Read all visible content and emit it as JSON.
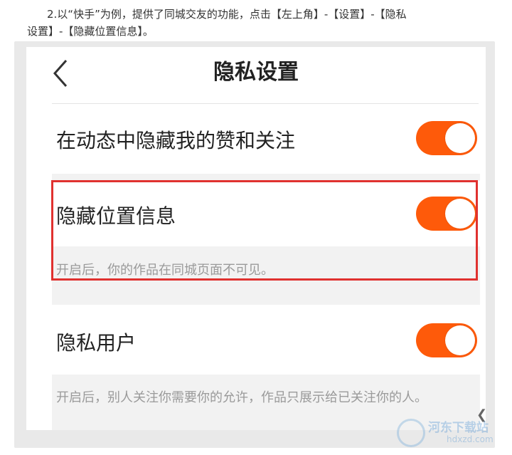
{
  "article": {
    "line1": "2.以“快手”为例，提供了同城交友的功能，点击【左上角】-【设置】-【隐私",
    "line2": "设置】-【隐藏位置信息】。"
  },
  "screen": {
    "title": "隐私设置",
    "back_icon": "chevron-left-icon",
    "accent": "#fe5a0a",
    "highlight_color": "#e0312f",
    "settings": [
      {
        "label": "在动态中隐藏我的赞和关注",
        "enabled": true
      },
      {
        "label": "隐藏位置信息",
        "enabled": true,
        "description": "开启后，你的作品在同城页面不可见。"
      },
      {
        "label": "隐私用户",
        "enabled": true,
        "description": "开启后，别人关注你需要你的允许，作品只展示给已关注你的人。"
      }
    ]
  },
  "watermark": {
    "text": "河东下载站",
    "url": "hdxzd.com"
  }
}
